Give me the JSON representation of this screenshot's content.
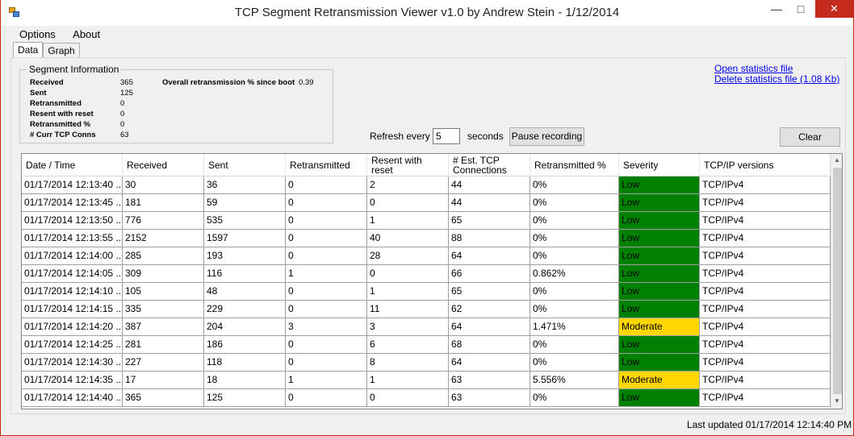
{
  "window": {
    "title": "TCP Segment Retransmission Viewer v1.0 by Andrew Stein - 1/12/2014",
    "min_icon": "minimize-icon",
    "max_icon": "maximize-icon",
    "close_icon": "close-icon",
    "min_glyph": "—",
    "max_glyph": "□",
    "close_glyph": "✕"
  },
  "menu": [
    {
      "label": "Options"
    },
    {
      "label": "About"
    }
  ],
  "tabs": [
    {
      "label": "Data",
      "active": true
    },
    {
      "label": "Graph",
      "active": false
    }
  ],
  "segment_info": {
    "title": "Segment Information",
    "rows": [
      {
        "label": "Received",
        "value": "365"
      },
      {
        "label": "Sent",
        "value": "125"
      },
      {
        "label": "Retransmitted",
        "value": "0"
      },
      {
        "label": "Resent with reset",
        "value": "0"
      },
      {
        "label": "Retransmitted %",
        "value": "0"
      },
      {
        "label": "# Curr TCP Conns",
        "value": "63"
      }
    ],
    "overall_label": "Overall retransmission % since boot",
    "overall_value": "0.39"
  },
  "links": {
    "open_stats": "Open statistics file",
    "delete_stats": "Delete statistics file (1.08 Kb)"
  },
  "controls": {
    "refresh_label": "Refresh every",
    "refresh_value": "5",
    "seconds_label": "seconds",
    "pause_button": "Pause recording",
    "clear_button": "Clear"
  },
  "table": {
    "columns": [
      {
        "label": "Date / Time"
      },
      {
        "label": "Received"
      },
      {
        "label": "Sent"
      },
      {
        "label": "Retransmitted"
      },
      {
        "label": "Resent with reset"
      },
      {
        "label": "# Est. TCP Connections"
      },
      {
        "label": "Retransmitted %"
      },
      {
        "label": "Severity"
      },
      {
        "label": "TCP/IP versions"
      }
    ],
    "rows": [
      [
        "01/17/2014 12:13:40 ...",
        "30",
        "36",
        "0",
        "2",
        "44",
        "0%",
        "Low",
        "TCP/IPv4"
      ],
      [
        "01/17/2014 12:13:45 ...",
        "181",
        "59",
        "0",
        "0",
        "44",
        "0%",
        "Low",
        "TCP/IPv4"
      ],
      [
        "01/17/2014 12:13:50 ...",
        "776",
        "535",
        "0",
        "1",
        "65",
        "0%",
        "Low",
        "TCP/IPv4"
      ],
      [
        "01/17/2014 12:13:55 ...",
        "2152",
        "1597",
        "0",
        "40",
        "88",
        "0%",
        "Low",
        "TCP/IPv4"
      ],
      [
        "01/17/2014 12:14:00 ...",
        "285",
        "193",
        "0",
        "28",
        "64",
        "0%",
        "Low",
        "TCP/IPv4"
      ],
      [
        "01/17/2014 12:14:05 ...",
        "309",
        "116",
        "1",
        "0",
        "66",
        "0.862%",
        "Low",
        "TCP/IPv4"
      ],
      [
        "01/17/2014 12:14:10 ...",
        "105",
        "48",
        "0",
        "1",
        "65",
        "0%",
        "Low",
        "TCP/IPv4"
      ],
      [
        "01/17/2014 12:14:15 ...",
        "335",
        "229",
        "0",
        "11",
        "62",
        "0%",
        "Low",
        "TCP/IPv4"
      ],
      [
        "01/17/2014 12:14:20 ...",
        "387",
        "204",
        "3",
        "3",
        "64",
        "1.471%",
        "Moderate",
        "TCP/IPv4"
      ],
      [
        "01/17/2014 12:14:25 ...",
        "281",
        "186",
        "0",
        "6",
        "68",
        "0%",
        "Low",
        "TCP/IPv4"
      ],
      [
        "01/17/2014 12:14:30 ...",
        "227",
        "118",
        "0",
        "8",
        "64",
        "0%",
        "Low",
        "TCP/IPv4"
      ],
      [
        "01/17/2014 12:14:35 ...",
        "17",
        "18",
        "1",
        "1",
        "63",
        "5.556%",
        "Moderate",
        "TCP/IPv4"
      ],
      [
        "01/17/2014 12:14:40 ...",
        "365",
        "125",
        "0",
        "0",
        "63",
        "0%",
        "Low",
        "TCP/IPv4"
      ]
    ],
    "severity_colors": {
      "Low": "#008000",
      "Moderate": "#ffd700"
    }
  },
  "status": {
    "last_updated": "Last updated 01/17/2014 12:14:40 PM"
  }
}
